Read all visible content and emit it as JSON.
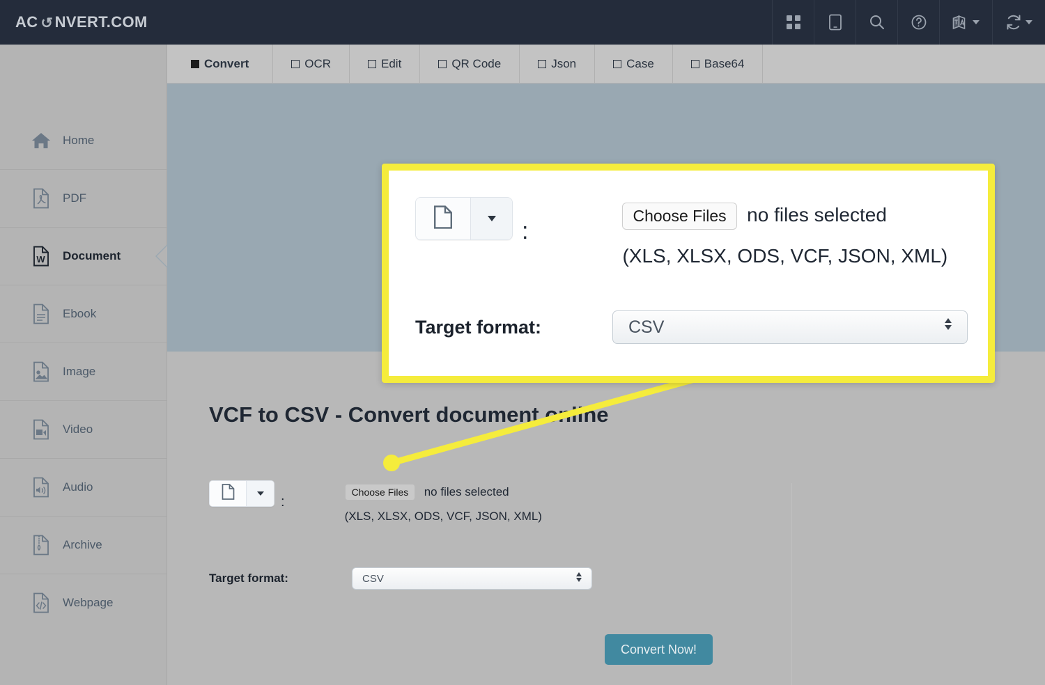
{
  "brand": {
    "logo_prefix": "AC",
    "logo_icon": "refresh-circular-arrow-icon",
    "logo_suffix": "NVERT.COM"
  },
  "topbar": {
    "icons": [
      {
        "name": "apps-grid-icon",
        "label": "Apps"
      },
      {
        "name": "tablet-icon",
        "label": "Mobile"
      },
      {
        "name": "search-icon",
        "label": "Search"
      },
      {
        "name": "help-circle-icon",
        "label": "Help"
      },
      {
        "name": "translate-icon",
        "label": "Language"
      },
      {
        "name": "refresh-icon",
        "label": "Convert"
      }
    ]
  },
  "tabs": [
    {
      "label": "Convert",
      "active": true
    },
    {
      "label": "OCR",
      "active": false
    },
    {
      "label": "Edit",
      "active": false
    },
    {
      "label": "QR Code",
      "active": false
    },
    {
      "label": "Json",
      "active": false
    },
    {
      "label": "Case",
      "active": false
    },
    {
      "label": "Base64",
      "active": false
    }
  ],
  "sidebar": {
    "items": [
      {
        "label": "Home",
        "icon": "home-icon",
        "active": false
      },
      {
        "label": "PDF",
        "icon": "pdf-file-icon",
        "active": false
      },
      {
        "label": "Document",
        "icon": "word-document-icon",
        "active": true
      },
      {
        "label": "Ebook",
        "icon": "ebook-file-icon",
        "active": false
      },
      {
        "label": "Image",
        "icon": "image-file-icon",
        "active": false
      },
      {
        "label": "Video",
        "icon": "video-file-icon",
        "active": false
      },
      {
        "label": "Audio",
        "icon": "audio-file-icon",
        "active": false
      },
      {
        "label": "Archive",
        "icon": "archive-zip-file-icon",
        "active": false
      },
      {
        "label": "Webpage",
        "icon": "code-file-icon",
        "active": false
      }
    ]
  },
  "main": {
    "page_title": "VCF to CSV - Convert document online",
    "form": {
      "source_type_icon": "document-file-icon",
      "source_dropdown_caret": "chevron-down-icon",
      "colon": ":",
      "choose_files_label": "Choose Files",
      "no_files_text": "no files selected",
      "accepted_formats": "(XLS, XLSX, ODS, VCF, JSON, XML)",
      "target_format_label": "Target format:",
      "target_format_value": "CSV"
    },
    "convert_button_label": "Convert Now!"
  },
  "callout": {
    "highlight_color": "#f5ec3c",
    "form": {
      "source_type_icon": "document-file-icon",
      "source_dropdown_caret": "chevron-down-icon",
      "colon": ":",
      "choose_files_label": "Choose Files",
      "no_files_text": "no files selected",
      "accepted_formats": "(XLS, XLSX, ODS, VCF, JSON, XML)",
      "target_format_label": "Target format:",
      "target_format_value": "CSV"
    }
  },
  "colors": {
    "topbar": "#242c3b",
    "sidebar": "#b4b4b4",
    "hero": "#99a8b2",
    "content": "#b8b8b8",
    "accent_button": "#4189a0",
    "highlight": "#f5ec3c"
  }
}
